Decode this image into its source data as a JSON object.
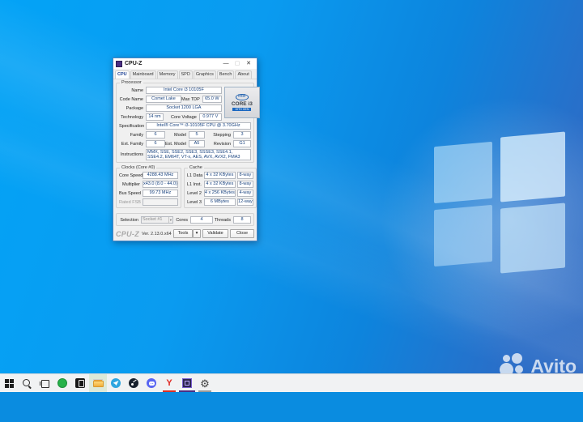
{
  "cpuz": {
    "title": "CPU-Z",
    "controls": {
      "minimize": "—",
      "maximize": "▢",
      "close": "✕"
    },
    "tabs": [
      "CPU",
      "Mainboard",
      "Memory",
      "SPD",
      "Graphics",
      "Bench",
      "About"
    ],
    "proc": {
      "group": "Processor",
      "name_l": "Name",
      "name": "Intel Core i3 10105F",
      "code_l": "Code Name",
      "code": "Comet Lake",
      "tdp_l": "Max TDP",
      "tdp": "65.0 W",
      "pkg_l": "Package",
      "pkg": "Socket 1200 LGA",
      "tech_l": "Technology",
      "tech": "14 nm",
      "volt_l": "Core Voltage",
      "volt": "0.977 V",
      "spec_l": "Specification",
      "spec": "Intel® Core™ i3-10105F CPU @ 3.70GHz",
      "family_l": "Family",
      "family": "6",
      "model_l": "Model",
      "model": "5",
      "stepping_l": "Stepping",
      "stepping": "3",
      "extfamily_l": "Ext. Family",
      "extfamily": "6",
      "extmodel_l": "Ext. Model",
      "extmodel": "A5",
      "revision_l": "Revision",
      "revision": "G1",
      "instr_l": "Instructions",
      "instr": "MMX, SSE, SSE2, SSE3, SSSE3, SSE4.1, SSE4.2, EM64T, VT-x, AES, AVX, AVX2, FMA3",
      "logo": {
        "brand": "intel",
        "line1": "CORE i3",
        "line2": "10TH GEN"
      }
    },
    "clocks": {
      "group": "Clocks (Core #0)",
      "speed_l": "Core Speed",
      "speed": "4288.43 MHz",
      "mult_l": "Multiplier",
      "mult": "x43.0 (8.0 - 44.0)",
      "bus_l": "Bus Speed",
      "bus": "99.73 MHz",
      "fsb_l": "Rated FSB",
      "fsb": ""
    },
    "cache": {
      "group": "Cache",
      "l1d_l": "L1 Data",
      "l1d": "4 x 32 KBytes",
      "l1d_w": "8-way",
      "l1i_l": "L1 Inst.",
      "l1i": "4 x 32 KBytes",
      "l1i_w": "8-way",
      "l2_l": "Level 2",
      "l2": "4 x 256 KBytes",
      "l2_w": "4-way",
      "l3_l": "Level 3",
      "l3": "6 MBytes",
      "l3_w": "12-way"
    },
    "bottom": {
      "sel_l": "Selection",
      "sel": "Socket #1",
      "cores_l": "Cores",
      "cores": "4",
      "threads_l": "Threads",
      "threads": "8"
    },
    "footer": {
      "brand": "CPU-Z",
      "version": "Ver. 2.13.0.x64",
      "tools": "Tools",
      "tools_arrow": "▾",
      "validate": "Validate",
      "close": "Close"
    }
  },
  "taskbar": {
    "yandex_glyph": "Y",
    "gear_glyph": "⚙",
    "items": [
      "start",
      "search",
      "task-view",
      "green-app",
      "dark-app",
      "file-explorer",
      "telegram",
      "steam",
      "discord",
      "yandex-browser",
      "cpu-z",
      "settings"
    ]
  },
  "watermark": {
    "text": "Avito"
  },
  "colors": {
    "wallpaper_top": "#03a3f6",
    "wallpaper_bottom": "#2f6ac2",
    "taskbar": "#f1f2f3",
    "accent_field_text": "#17417e",
    "underline_red": "#d93025",
    "underline_purple": "#4b2e83"
  }
}
